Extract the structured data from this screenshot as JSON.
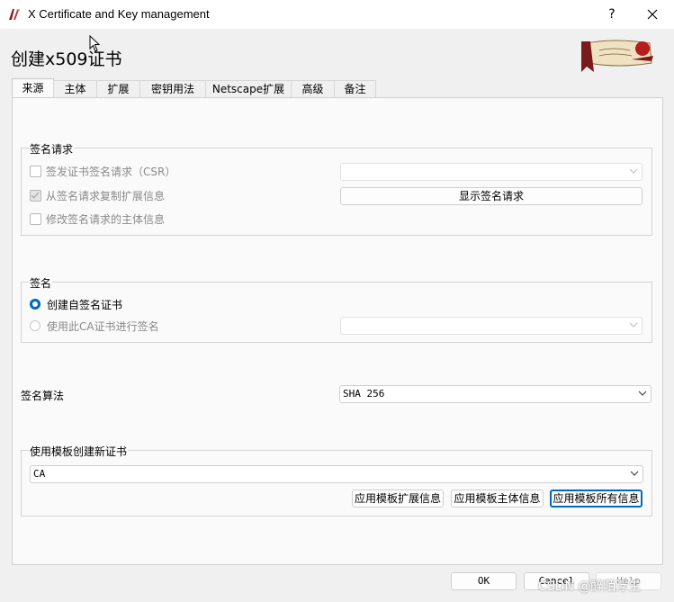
{
  "window": {
    "title": "X Certificate and Key management",
    "help": "?",
    "close": "✕"
  },
  "page_title": "创建x509证书",
  "tabs": [
    "来源",
    "主体",
    "扩展",
    "密钥用法",
    "Netscape扩展",
    "高级",
    "备注"
  ],
  "sign_request": {
    "legend": "签名请求",
    "csr_label": "签发证书签名请求（CSR）",
    "csr_checked": false,
    "copy_ext_label": "从签名请求复制扩展信息",
    "copy_ext_checked": true,
    "modify_subject_label": "修改签名请求的主体信息",
    "modify_subject_checked": false,
    "csr_combo_value": "",
    "show_request_button": "显示签名请求"
  },
  "signing": {
    "legend": "签名",
    "self_signed_label": "创建自签名证书",
    "self_signed_selected": true,
    "ca_sign_label": "使用此CA证书进行签名",
    "ca_combo_value": ""
  },
  "algorithm": {
    "label": "签名算法",
    "value": "SHA 256"
  },
  "template": {
    "legend": "使用模板创建新证书",
    "value": "CA",
    "apply_ext_button": "应用模板扩展信息",
    "apply_subject_button": "应用模板主体信息",
    "apply_all_button": "应用模板所有信息"
  },
  "footer": {
    "ok": "OK",
    "cancel": "Cancel",
    "help": "Help"
  },
  "watermark": "CSDN @醉陌浮生",
  "colors": {
    "accent": "#0067c0",
    "panel": "#fafafa",
    "window": "#f0f0f0"
  }
}
